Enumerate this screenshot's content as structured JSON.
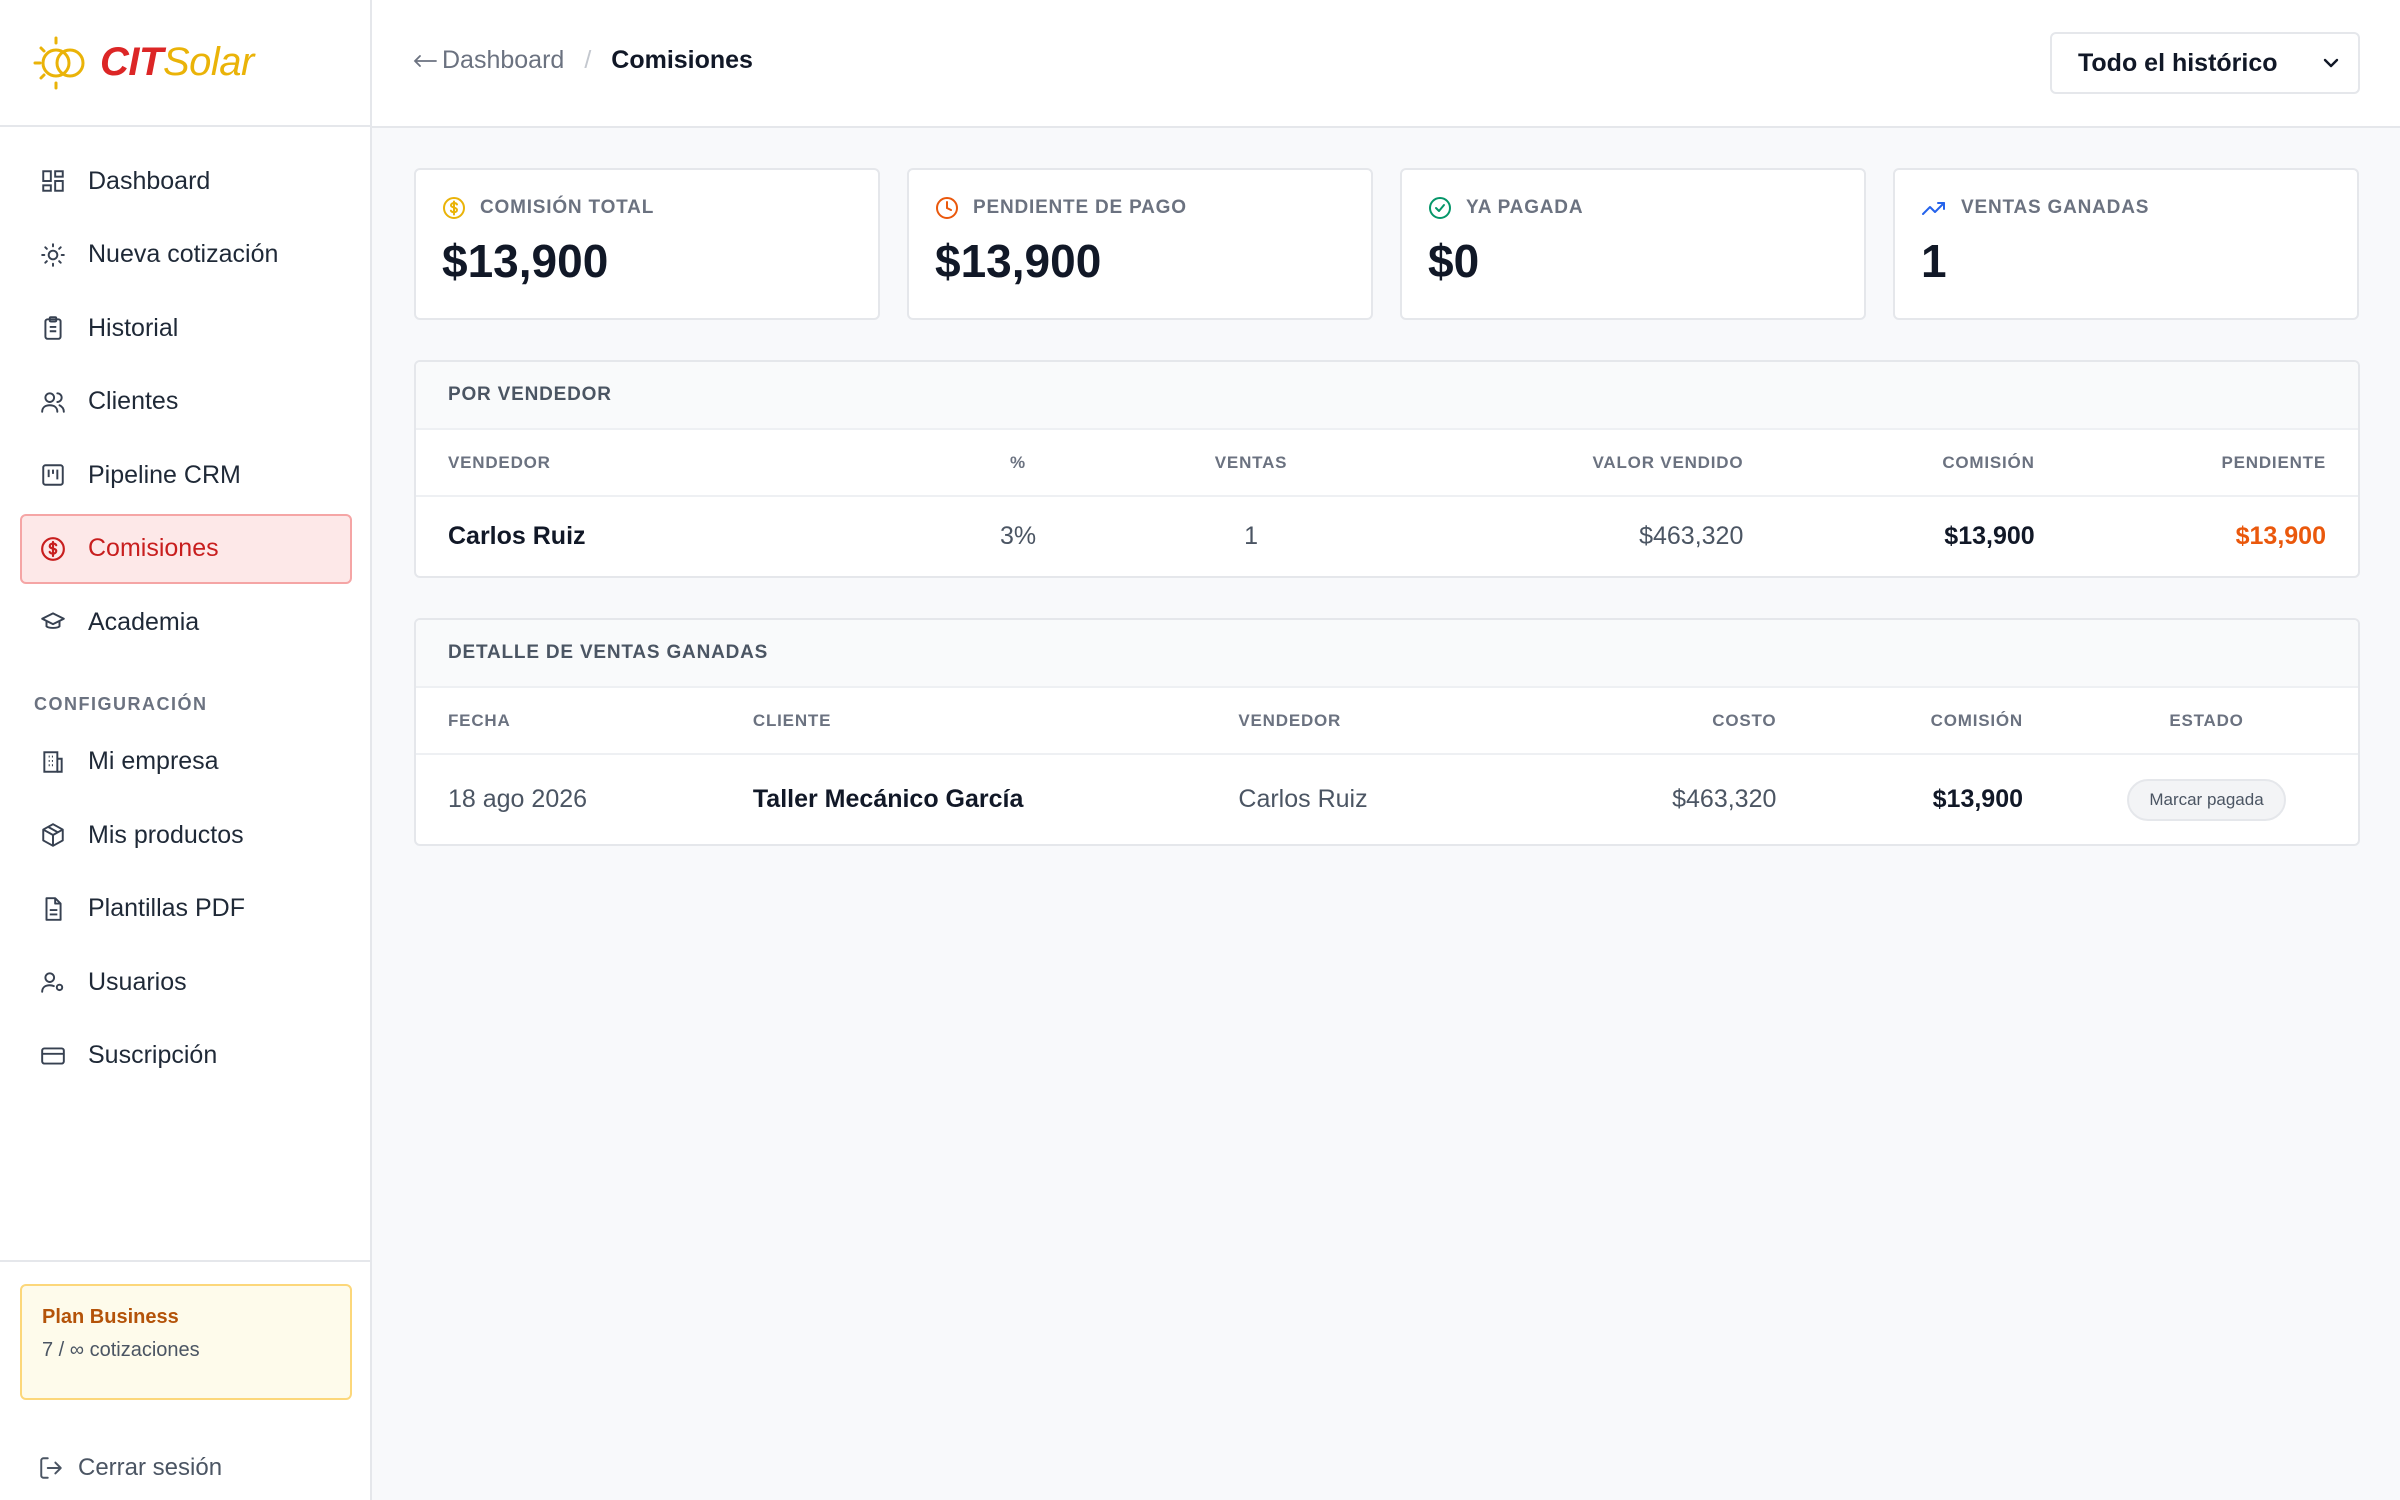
{
  "brand": {
    "part1": "CIT",
    "part2": "Solar"
  },
  "sidebar": {
    "items": [
      {
        "label": "Dashboard",
        "icon": "dashboard-icon"
      },
      {
        "label": "Nueva cotización",
        "icon": "sun-icon"
      },
      {
        "label": "Historial",
        "icon": "clipboard-icon"
      },
      {
        "label": "Clientes",
        "icon": "users-icon"
      },
      {
        "label": "Pipeline CRM",
        "icon": "kanban-icon"
      },
      {
        "label": "Comisiones",
        "icon": "dollar-circle-icon",
        "active": true
      },
      {
        "label": "Academia",
        "icon": "graduation-cap-icon"
      }
    ],
    "section_label": "CONFIGURACIÓN",
    "config_items": [
      {
        "label": "Mi empresa",
        "icon": "building-icon"
      },
      {
        "label": "Mis productos",
        "icon": "package-icon"
      },
      {
        "label": "Plantillas PDF",
        "icon": "file-icon"
      },
      {
        "label": "Usuarios",
        "icon": "user-settings-icon"
      },
      {
        "label": "Suscripción",
        "icon": "credit-card-icon"
      }
    ],
    "plan": {
      "title": "Plan Business",
      "usage": "7 / ∞ cotizaciones"
    },
    "logout_label": "Cerrar sesión"
  },
  "header": {
    "breadcrumb_back": "Dashboard",
    "breadcrumb_sep": "/",
    "breadcrumb_current": "Comisiones",
    "range_selected": "Todo el histórico"
  },
  "stats": [
    {
      "label": "COMISIÓN TOTAL",
      "value": "$13,900",
      "icon": "dollar-circle-icon",
      "color": "#eab308"
    },
    {
      "label": "PENDIENTE DE PAGO",
      "value": "$13,900",
      "icon": "clock-icon",
      "color": "#ea580c"
    },
    {
      "label": "YA PAGADA",
      "value": "$0",
      "icon": "check-circle-icon",
      "color": "#059669"
    },
    {
      "label": "VENTAS GANADAS",
      "value": "1",
      "icon": "trending-up-icon",
      "color": "#2563eb"
    }
  ],
  "by_seller": {
    "title": "POR VENDEDOR",
    "columns": [
      "VENDEDOR",
      "%",
      "VENTAS",
      "VALOR VENDIDO",
      "COMISIÓN",
      "PENDIENTE"
    ],
    "rows": [
      {
        "seller": "Carlos Ruiz",
        "pct": "3%",
        "sales": "1",
        "sold": "$463,320",
        "commission": "$13,900",
        "pending": "$13,900"
      }
    ]
  },
  "detail": {
    "title": "DETALLE DE VENTAS GANADAS",
    "columns": [
      "FECHA",
      "CLIENTE",
      "VENDEDOR",
      "COSTO",
      "COMISIÓN",
      "ESTADO"
    ],
    "rows": [
      {
        "date": "18 ago 2026",
        "client": "Taller Mecánico García",
        "seller": "Carlos Ruiz",
        "cost": "$463,320",
        "commission": "$13,900",
        "action": "Marcar pagada"
      }
    ]
  },
  "colors": {
    "accent": "#c81e1e",
    "active_bg": "#fde8e8",
    "pending": "#ea580c",
    "plan": "#b45309"
  }
}
